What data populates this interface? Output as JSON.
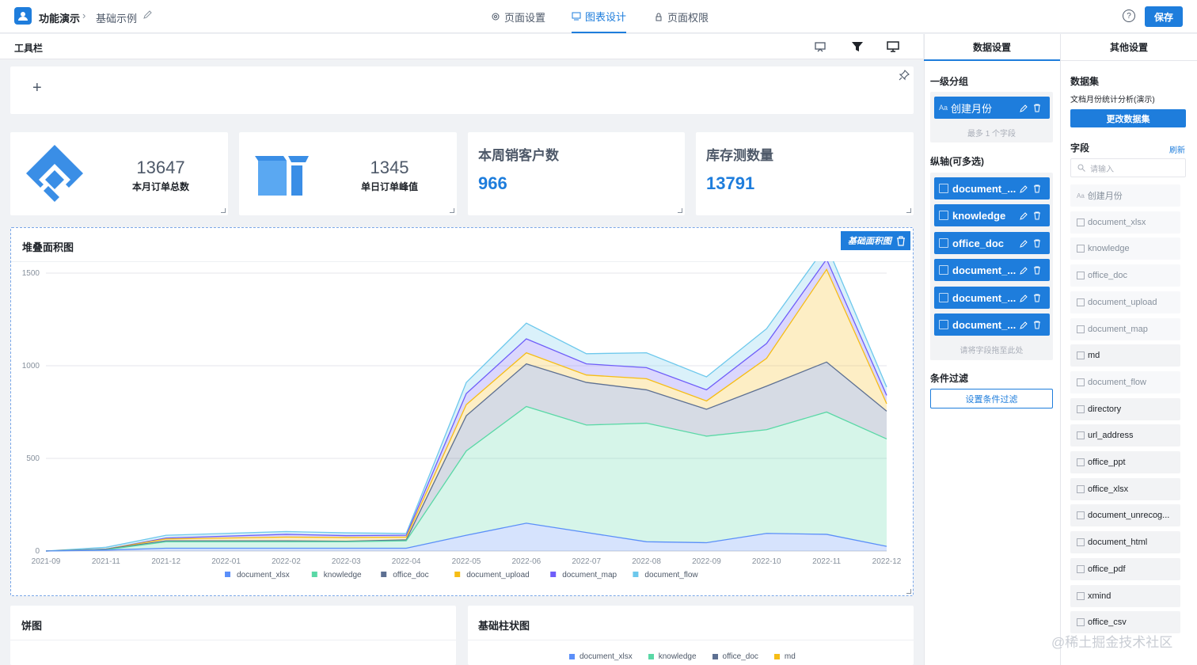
{
  "header": {
    "app_title": "功能演示",
    "page_name": "基础示例",
    "tabs": [
      {
        "label": "页面设置",
        "icon": "gear-icon"
      },
      {
        "label": "图表设计",
        "icon": "chart-icon"
      },
      {
        "label": "页面权限",
        "icon": "lock-icon"
      }
    ],
    "save_label": "保存",
    "help_label": "?"
  },
  "toolbar": {
    "title": "工具栏",
    "add_label": "+"
  },
  "stats": [
    {
      "value": "13647",
      "label": "本月订单总数"
    },
    {
      "value": "1345",
      "label": "单日订单峰值"
    }
  ],
  "kpis": [
    {
      "title": "本周销客户数",
      "value": "966"
    },
    {
      "title": "库存测数量",
      "value": "13791"
    }
  ],
  "area_card": {
    "title": "堆叠面积图",
    "badge": "基础面积图"
  },
  "pie_card": {
    "title": "饼图"
  },
  "bar_card": {
    "title": "基础柱状图",
    "legend": [
      "document_xlsx",
      "knowledge",
      "office_doc",
      "md"
    ]
  },
  "colors": {
    "accent": "#1e7ddc",
    "document_xlsx": "#5b8ff9",
    "knowledge": "#5ad8a6",
    "office_doc": "#5d7092",
    "document_upload": "#f6bd16",
    "document_map": "#6f5ef9",
    "document_flow": "#6dc8ec",
    "md": "#f6bd16"
  },
  "chart_data": {
    "type": "area",
    "stacked": true,
    "title": "堆叠面积图",
    "x": [
      "2021-09",
      "2021-11",
      "2021-12",
      "2022-01",
      "2022-02",
      "2022-03",
      "2022-04",
      "2022-05",
      "2022-06",
      "2022-07",
      "2022-08",
      "2022-09",
      "2022-10",
      "2022-11",
      "2022-12"
    ],
    "ylim": [
      0,
      1500
    ],
    "yticks": [
      "0",
      "500",
      "1000",
      "1500"
    ],
    "grid": true,
    "legend_position": "bottom",
    "series": [
      {
        "name": "document_xlsx",
        "values": [
          0,
          5,
          15,
          15,
          15,
          15,
          15,
          85,
          150,
          100,
          50,
          45,
          95,
          90,
          25
        ]
      },
      {
        "name": "knowledge",
        "values": [
          0,
          2,
          35,
          35,
          35,
          35,
          40,
          455,
          630,
          580,
          640,
          575,
          560,
          660,
          580
        ]
      },
      {
        "name": "office_doc",
        "values": [
          0,
          3,
          5,
          5,
          5,
          3,
          5,
          190,
          230,
          230,
          180,
          145,
          235,
          270,
          150
        ]
      },
      {
        "name": "document_upload",
        "values": [
          0,
          0,
          10,
          15,
          20,
          20,
          15,
          60,
          60,
          40,
          60,
          45,
          150,
          500,
          40
        ]
      },
      {
        "name": "document_map",
        "values": [
          0,
          0,
          5,
          10,
          15,
          10,
          10,
          60,
          75,
          60,
          60,
          60,
          80,
          55,
          45
        ]
      },
      {
        "name": "document_flow",
        "values": [
          0,
          10,
          15,
          15,
          15,
          15,
          10,
          60,
          85,
          55,
          80,
          70,
          80,
          75,
          45
        ]
      }
    ]
  },
  "data_tabs": {
    "data": "数据设置",
    "other": "其他设置"
  },
  "group": {
    "label": "一级分组",
    "chip": "创建月份",
    "hint": "最多 1 个字段"
  },
  "yaxis": {
    "label": "纵轴(可多选)",
    "chips": [
      "document_...",
      "knowledge",
      "office_doc",
      "document_...",
      "document_...",
      "document_..."
    ],
    "hint": "请将字段拖至此处"
  },
  "filter": {
    "label": "条件过滤",
    "button": "设置条件过滤"
  },
  "dataset": {
    "label": "数据集",
    "name": "文档月份统计分析(演示)",
    "change_button": "更改数据集"
  },
  "fields": {
    "label": "字段",
    "refresh": "刷新",
    "search_placeholder": "请输入",
    "items": [
      {
        "name": "创建月份",
        "used": true
      },
      {
        "name": "document_xlsx",
        "used": true
      },
      {
        "name": "knowledge",
        "used": true
      },
      {
        "name": "office_doc",
        "used": true
      },
      {
        "name": "document_upload",
        "used": true
      },
      {
        "name": "document_map",
        "used": true
      },
      {
        "name": "md",
        "used": false
      },
      {
        "name": "document_flow",
        "used": true
      },
      {
        "name": "directory",
        "used": false
      },
      {
        "name": "url_address",
        "used": false
      },
      {
        "name": "office_ppt",
        "used": false
      },
      {
        "name": "office_xlsx",
        "used": false
      },
      {
        "name": "document_unrecog...",
        "used": false
      },
      {
        "name": "document_html",
        "used": false
      },
      {
        "name": "office_pdf",
        "used": false
      },
      {
        "name": "xmind",
        "used": false
      },
      {
        "name": "office_csv",
        "used": false
      }
    ]
  },
  "watermark": "@稀土掘金技术社区"
}
